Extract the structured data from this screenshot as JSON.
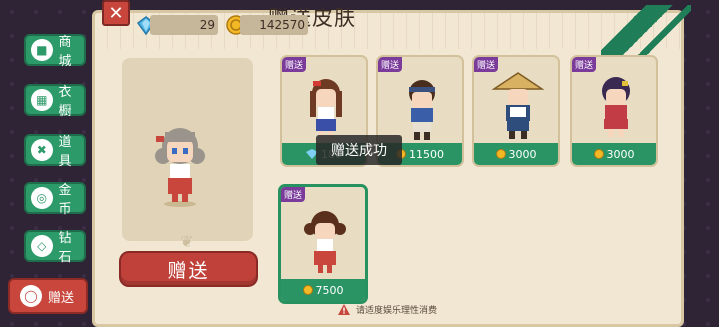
{
  "header": {
    "title": "赠送皮肤",
    "close_icon": "close-icon"
  },
  "currency": {
    "gems": "29",
    "coins": "142570"
  },
  "side_menu": {
    "items": [
      {
        "label": "商城",
        "icon": "shop-icon"
      },
      {
        "label": "衣橱",
        "icon": "wardrobe-icon"
      },
      {
        "label": "道具",
        "icon": "items-icon"
      },
      {
        "label": "金币",
        "icon": "coin-icon"
      },
      {
        "label": "钻石",
        "icon": "diamond-icon"
      },
      {
        "label": "赠送",
        "icon": "gift-icon",
        "active": true
      }
    ]
  },
  "preview": {
    "gift_button": "赠送"
  },
  "cards": [
    {
      "tag": "赠送",
      "price": "180",
      "currency": "gem",
      "selected": false
    },
    {
      "tag": "赠送",
      "price": "11500",
      "currency": "coin",
      "selected": false
    },
    {
      "tag": "赠送",
      "price": "3000",
      "currency": "coin",
      "selected": false
    },
    {
      "tag": "赠送",
      "price": "3000",
      "currency": "coin",
      "selected": false
    },
    {
      "tag": "赠送",
      "price": "7500",
      "currency": "coin",
      "selected": true
    }
  ],
  "toast": "赠送成功",
  "notice": "请适度娱乐理性消费",
  "colors": {
    "accent_green": "#2a9465",
    "accent_red": "#c0413a",
    "tag_purple": "#7a3b9b"
  }
}
